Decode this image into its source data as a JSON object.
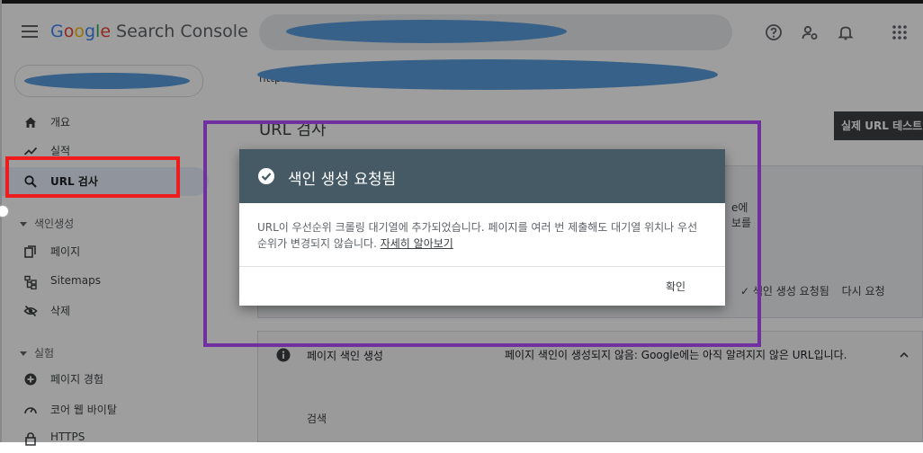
{
  "header": {
    "logo": {
      "g1": "G",
      "g2": "o",
      "g3": "o",
      "g4": "g",
      "g5": "l",
      "g6": "e",
      "product": "Search Console"
    }
  },
  "sidebar": {
    "items": [
      {
        "label": "개요",
        "icon": "home-icon"
      },
      {
        "label": "실적",
        "icon": "trend-icon"
      },
      {
        "label": "URL 검사",
        "icon": "search-icon",
        "active": true
      },
      {
        "label": "페이지",
        "icon": "pages-icon"
      },
      {
        "label": "Sitemaps",
        "icon": "sitemap-icon"
      },
      {
        "label": "삭제",
        "icon": "remove-icon"
      },
      {
        "label": "페이지 경험",
        "icon": "plus-circle-icon"
      },
      {
        "label": "코어 웹 바이탈",
        "icon": "gauge-icon"
      },
      {
        "label": "HTTPS",
        "icon": "lock-icon"
      }
    ],
    "sections": [
      {
        "label": "색인생성"
      },
      {
        "label": "실험"
      }
    ]
  },
  "main": {
    "url_prefix": "https:",
    "url_suffix": ".",
    "page_title": "URL 검사",
    "test_button": "실제 URL 테스트",
    "card1": {
      "side_line1": "e에",
      "side_line2": "보를",
      "action_requested": "색인 생성 요청됨",
      "action_retry": "다시 요청"
    },
    "card2": {
      "title": "페이지 색인 생성",
      "status": "페이지 색인이 생성되지 않음: Google에는 아직 알려지지 않은 URL입니다.",
      "sub": "검색"
    }
  },
  "dialog": {
    "title": "색인 생성 요청됨",
    "body": "URL이 우선순위 크롤링 대기열에 추가되었습니다. 페이지를 여러 번 제출해도 대기열 위치나 우선순위가 변경되지 않습니다.",
    "link": "자세히 알아보기",
    "ok": "확인"
  },
  "colors": {
    "dialog_header": "#455a64",
    "red_highlight": "#ee1c1c",
    "purple_highlight": "#7030a0",
    "redaction": "#5b9ddd"
  }
}
